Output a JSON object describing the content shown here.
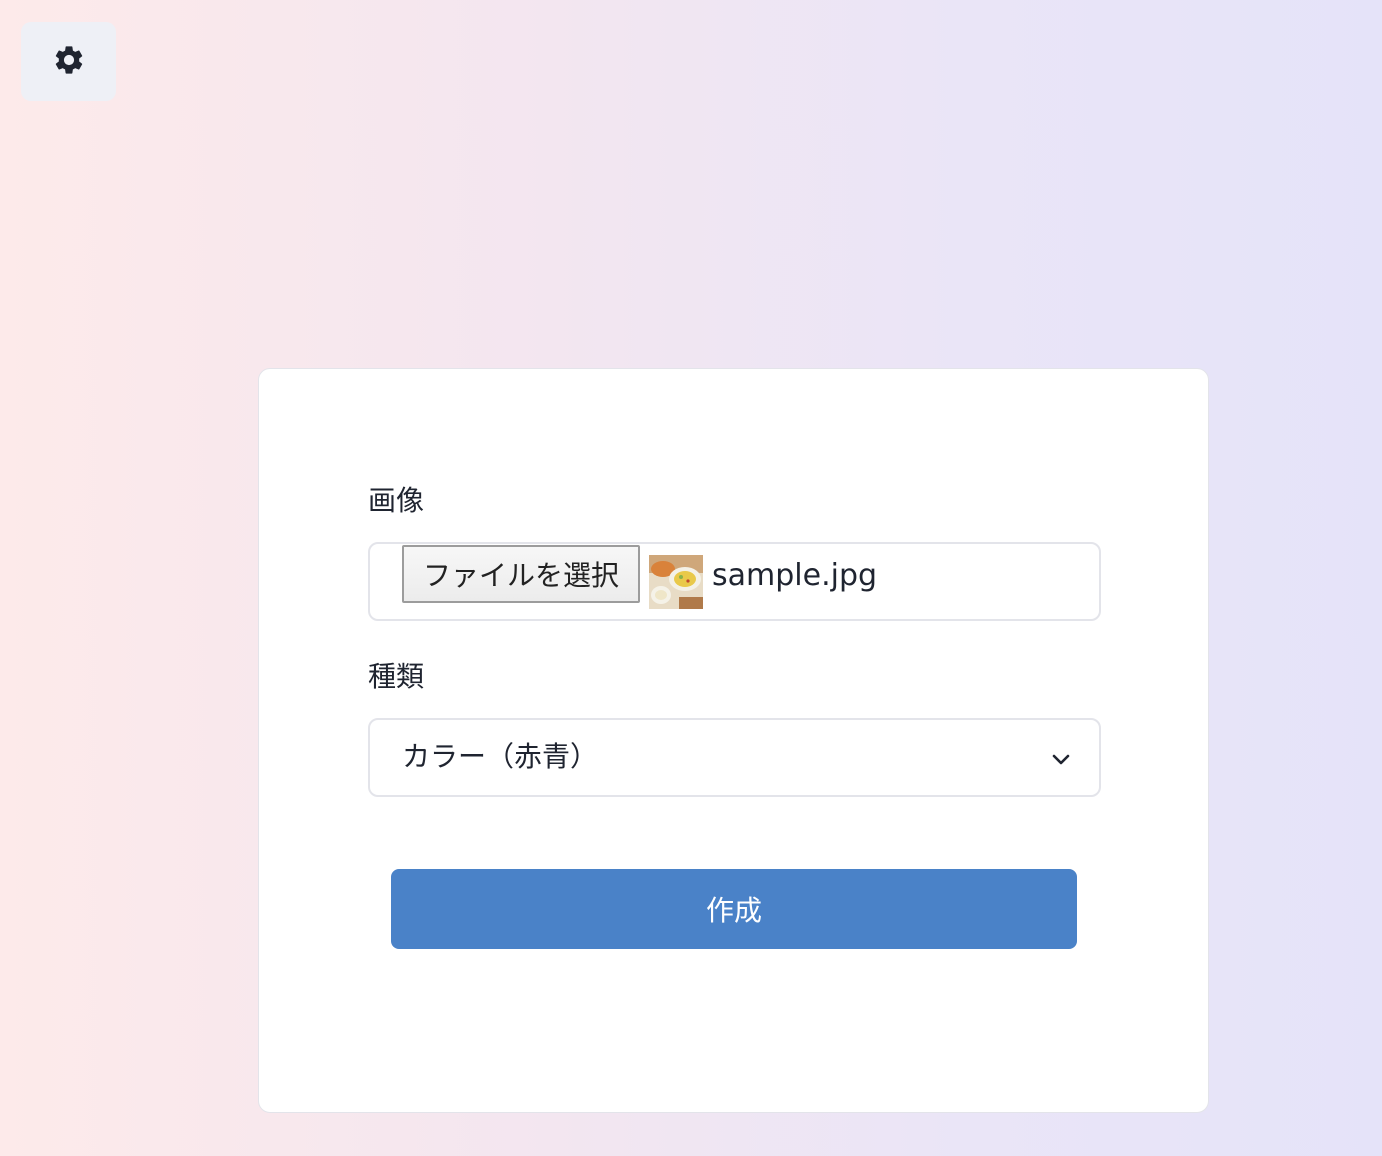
{
  "settings": {
    "icon": "gear-icon"
  },
  "form": {
    "image_label": "画像",
    "file_button_label": "ファイルを選択",
    "file_name": "sample.jpg",
    "thumbnail_icon": "image-thumbnail",
    "type_label": "種類",
    "type_selected": "カラー（赤青）",
    "submit_label": "作成"
  },
  "colors": {
    "primary_button": "#4a82c8",
    "background_left": "#fdeaea",
    "background_right": "#e5e3f9",
    "text": "#1f2430"
  }
}
